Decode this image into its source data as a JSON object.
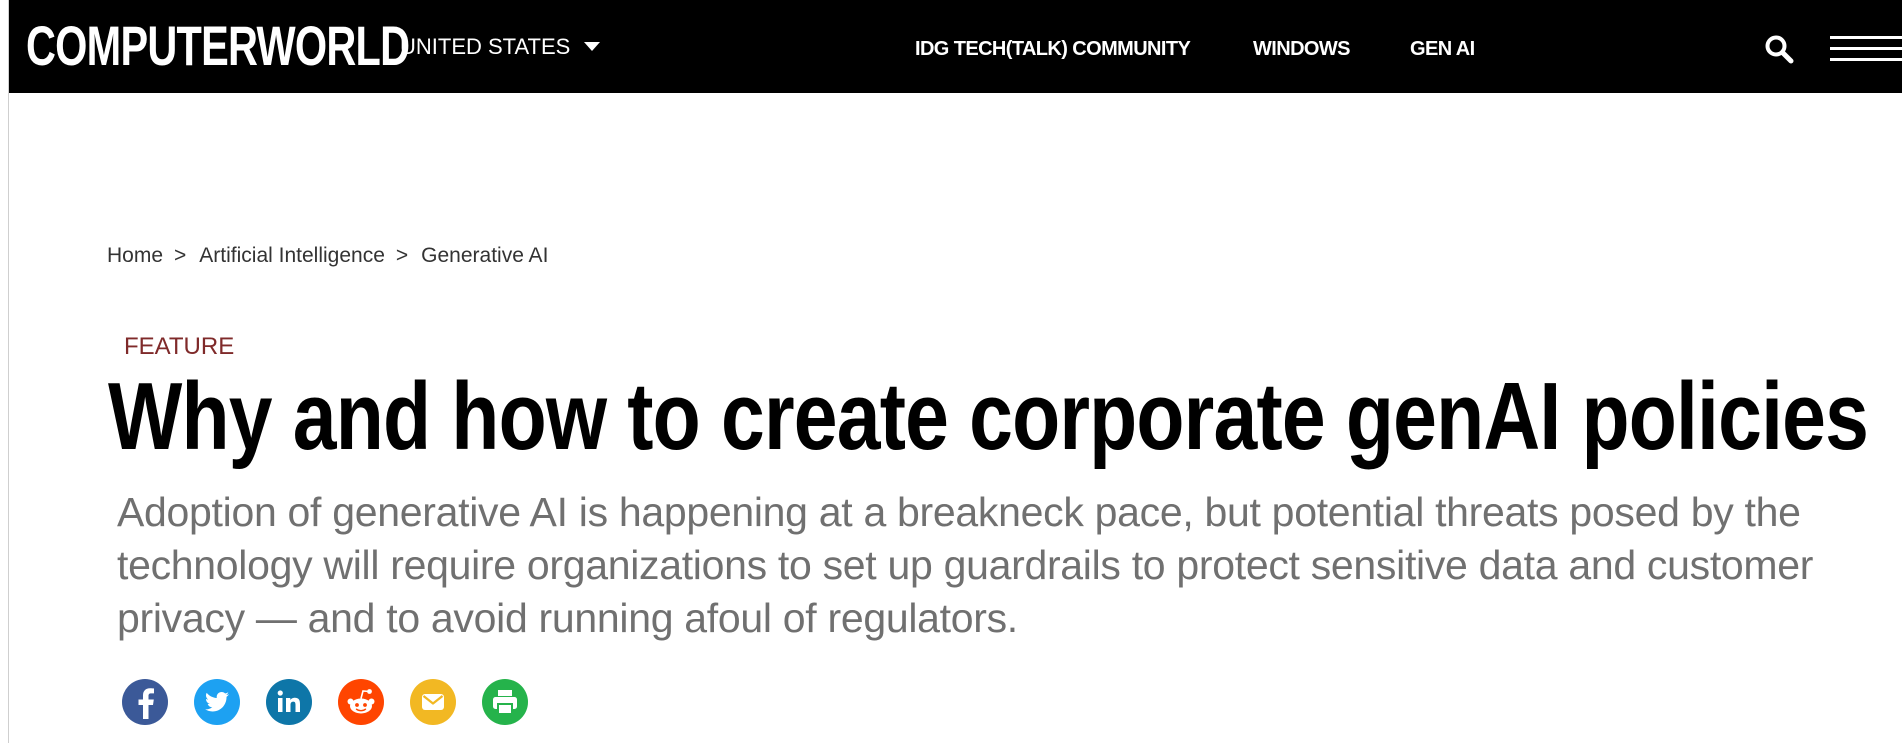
{
  "nav": {
    "logo": "COMPUTERWORLD",
    "region": "UNITED STATES",
    "links": [
      "IDG TECH(TALK) COMMUNITY",
      "WINDOWS",
      "GEN AI"
    ],
    "search_icon": "search-icon",
    "menu_icon": "hamburger-menu-icon"
  },
  "breadcrumb": [
    "Home",
    "Artificial Intelligence",
    "Generative AI"
  ],
  "breadcrumb_separator": ">",
  "article": {
    "kicker": "FEATURE",
    "headline": "Why and how to create corporate genAI policies",
    "dek": "Adoption of generative AI is happening at a breakneck pace, but potential threats posed by the technology will require organizations to set up guardrails to protect sensitive data and customer privacy — and to avoid running afoul of regulators."
  },
  "share": [
    {
      "icon": "facebook-icon",
      "color": "#3b5998"
    },
    {
      "icon": "twitter-icon",
      "color": "#1da1f2"
    },
    {
      "icon": "linkedin-icon",
      "color": "#0e76a8"
    },
    {
      "icon": "reddit-icon",
      "color": "#ff4500"
    },
    {
      "icon": "email-icon",
      "color": "#f2b823"
    },
    {
      "icon": "print-icon",
      "color": "#25b34b"
    }
  ],
  "colors": {
    "nav_bg": "#000000",
    "kicker": "#7f2a2a",
    "dek": "#707070"
  }
}
